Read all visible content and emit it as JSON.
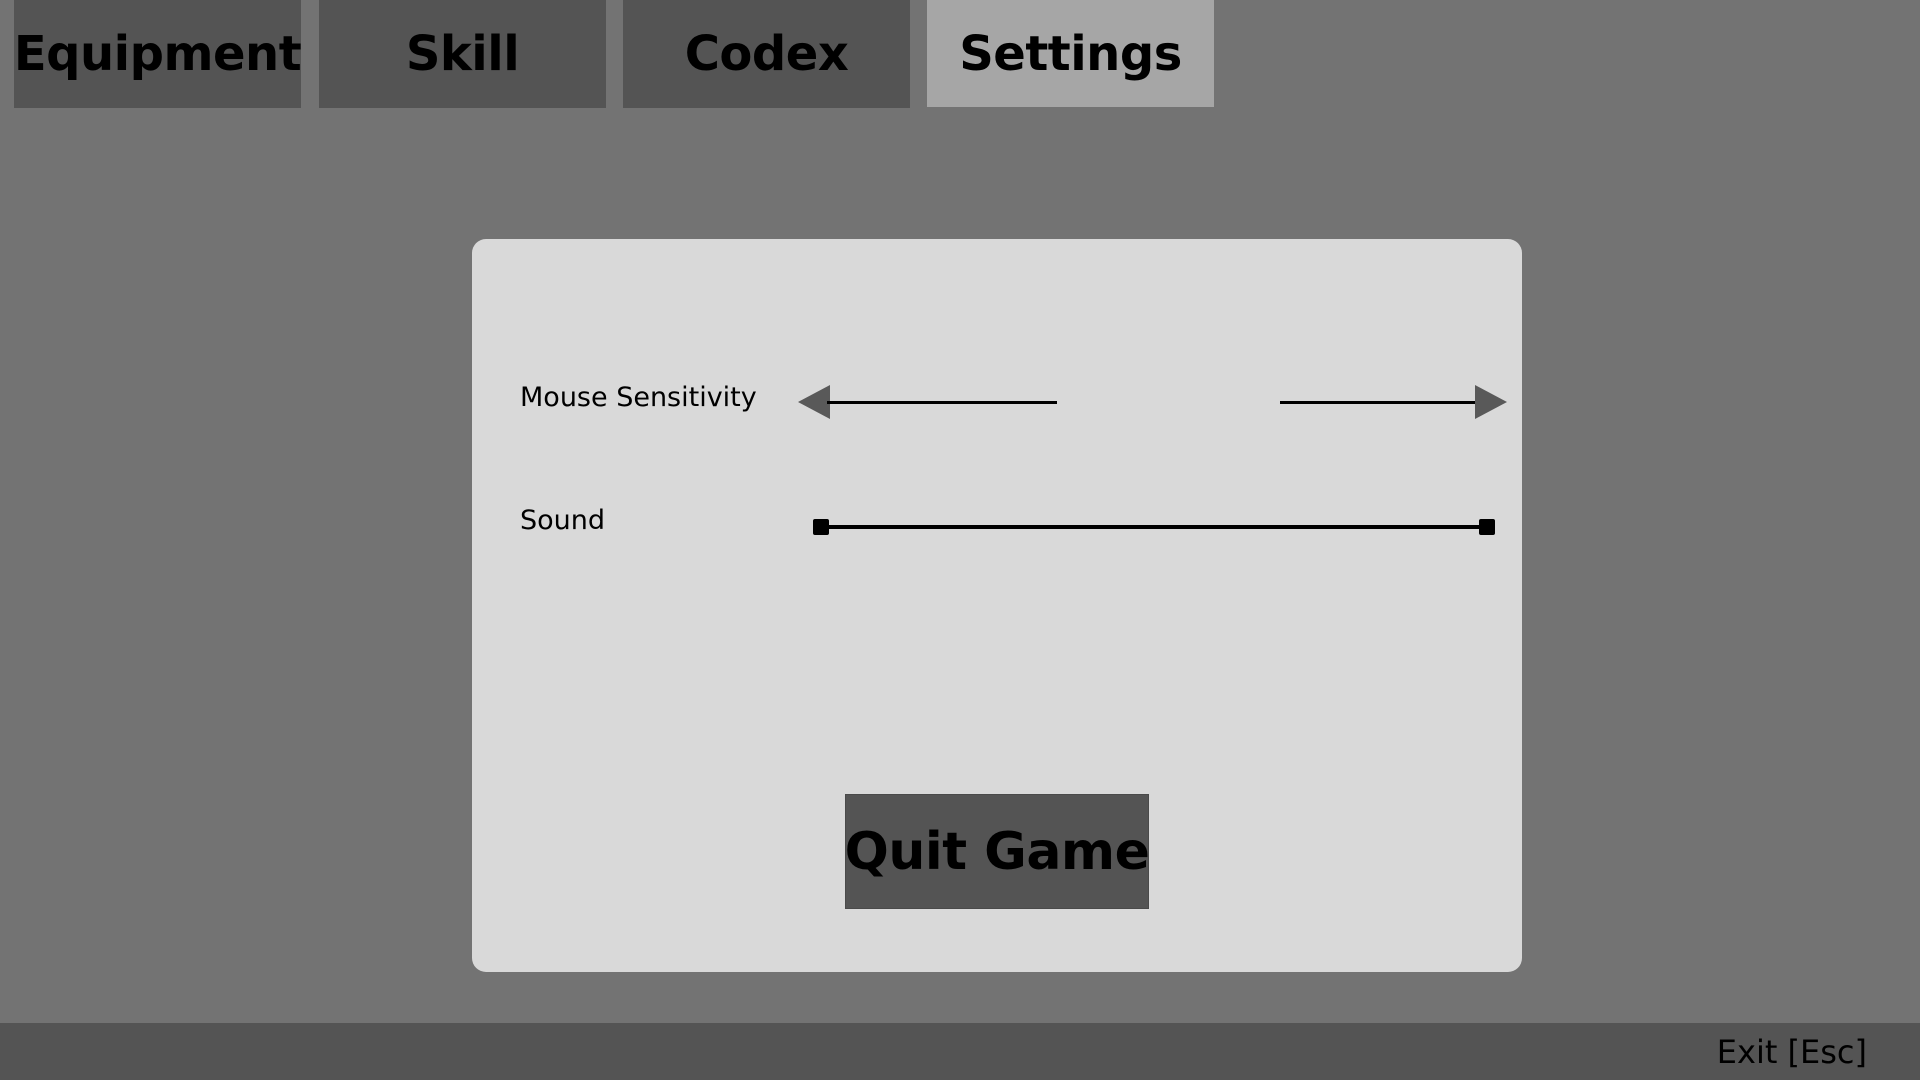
{
  "tabs": [
    {
      "label": "Equipment",
      "active": false
    },
    {
      "label": "Skill",
      "active": false
    },
    {
      "label": "Codex",
      "active": false
    },
    {
      "label": "Settings",
      "active": true
    }
  ],
  "settings": {
    "mouse_sensitivity_label": "Mouse Sensitivity",
    "sound_label": "Sound",
    "quit_button_label": "Quit Game"
  },
  "footer": {
    "exit_hint": "Exit [Esc]"
  },
  "colors": {
    "background": "#737373",
    "tab_inactive": "#545454",
    "tab_active": "#a6a6a6",
    "panel": "#d9d9d9",
    "footer": "#545454"
  }
}
